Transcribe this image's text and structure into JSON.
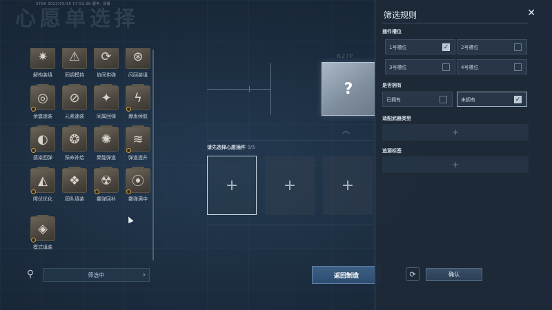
{
  "header": {
    "meta_text": "S7N5  2023/05/16 17:52:38    服务: 测服",
    "ghost_title": "心愿单选择"
  },
  "cards": [
    {
      "label": "解构装填",
      "icon": "burst-icon",
      "glyph": "✷",
      "dot": false
    },
    {
      "label": "同调模持",
      "icon": "triangle-icon",
      "glyph": "⚠",
      "dot": false
    },
    {
      "label": "协同供弹",
      "icon": "sync-icon",
      "glyph": "⟳",
      "dot": false
    },
    {
      "label": "闪回装填",
      "icon": "rewind-icon",
      "glyph": "⊛",
      "dot": false
    },
    {
      "label": "余震速装",
      "icon": "shockwave-icon",
      "glyph": "◎",
      "dot": true
    },
    {
      "label": "元素速装",
      "icon": "slash-circle-icon",
      "glyph": "⊘",
      "dot": false
    },
    {
      "label": "同属回弹",
      "icon": "spark-icon",
      "glyph": "✦",
      "dot": false
    },
    {
      "label": "爆发续航",
      "icon": "bolt-icon",
      "glyph": "ϟ",
      "dot": true
    },
    {
      "label": "感染回弹",
      "icon": "spiral-icon",
      "glyph": "◐",
      "dot": true
    },
    {
      "label": "殒命补给",
      "icon": "supply-icon",
      "glyph": "❂",
      "dot": false
    },
    {
      "label": "聚能弹道",
      "icon": "star-burst-icon",
      "glyph": "✺",
      "dot": false
    },
    {
      "label": "弹道提升",
      "icon": "bullets-icon",
      "glyph": "≋",
      "dot": true
    },
    {
      "label": "障伏优化",
      "icon": "wing-icon",
      "glyph": "◭",
      "dot": true
    },
    {
      "label": "团队填装",
      "icon": "team-icon",
      "glyph": "❖",
      "dot": false
    },
    {
      "label": "霰弹回补",
      "icon": "shell-icon",
      "glyph": "☢",
      "dot": true
    },
    {
      "label": "霰弹满中",
      "icon": "target-icon",
      "glyph": "⦿",
      "dot": true
    },
    {
      "label": "模式填装",
      "icon": "mode-icon",
      "glyph": "◈",
      "dot": true
    }
  ],
  "left_bar": {
    "search_glyph": "⚲",
    "filter_label": "筛选中",
    "chevron": "›"
  },
  "center": {
    "mystery_glyph": "?",
    "code_label": "N2?P",
    "up_glyph": "︿",
    "select_prompt": "请先选择心愿插件",
    "select_count": "0/5",
    "plus": "+",
    "return_label": "返回制造"
  },
  "filter": {
    "title": "筛选规则",
    "close_glyph": "✕",
    "slot_section": "插件槽位",
    "slots": [
      {
        "label": "1号槽位",
        "checked": true
      },
      {
        "label": "2号槽位",
        "checked": false
      },
      {
        "label": "3号槽位",
        "checked": false
      },
      {
        "label": "4号槽位",
        "checked": false
      }
    ],
    "own_section": "是否拥有",
    "own": [
      {
        "label": "已拥有",
        "checked": false
      },
      {
        "label": "未拥有",
        "checked": true
      }
    ],
    "weapon_section": "适配武器类型",
    "source_section": "追源标签",
    "plus": "+",
    "refresh_glyph": "⟳",
    "confirm_label": "确认",
    "check_glyph": "✓"
  },
  "colors": {
    "accent_blue": "#3c5f84",
    "card_bronze": "#6d6458",
    "badge_gold": "#d6a13a"
  }
}
